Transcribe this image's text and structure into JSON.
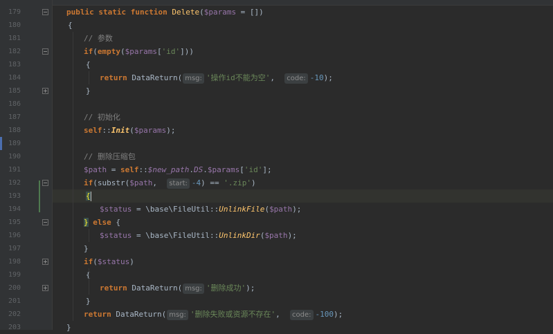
{
  "editor": {
    "lines": [
      {
        "n": "179",
        "parts": [
          [
            "kw",
            "public static function "
          ],
          [
            "fn",
            "Delete"
          ],
          [
            "txt",
            "("
          ],
          [
            "var",
            "$params"
          ],
          [
            "txt",
            " = [])"
          ]
        ]
      },
      {
        "n": "180",
        "parts": [
          [
            "txt",
            "{"
          ]
        ]
      },
      {
        "n": "181",
        "parts": [
          [
            "cmt",
            "// 参数"
          ]
        ]
      },
      {
        "n": "182",
        "parts": [
          [
            "kw",
            "if"
          ],
          [
            "txt",
            "("
          ],
          [
            "kw",
            "empty"
          ],
          [
            "txt",
            "("
          ],
          [
            "var",
            "$params"
          ],
          [
            "txt",
            "["
          ],
          [
            "str",
            "'id'"
          ],
          [
            "txt",
            "]))"
          ]
        ]
      },
      {
        "n": "183",
        "parts": [
          [
            "txt",
            "{"
          ]
        ]
      },
      {
        "n": "184",
        "parts": [
          [
            "kw",
            "return "
          ],
          [
            "txt",
            "DataReturn("
          ],
          [
            "hint",
            "msg:"
          ],
          [
            "str",
            "'操作id不能为空'"
          ],
          [
            "txt",
            ",  "
          ],
          [
            "hint",
            "code:"
          ],
          [
            "num",
            "-10"
          ],
          [
            "txt",
            ");"
          ]
        ]
      },
      {
        "n": "185",
        "parts": [
          [
            "txt",
            "}"
          ]
        ]
      },
      {
        "n": "186",
        "parts": []
      },
      {
        "n": "187",
        "parts": [
          [
            "cmt",
            "// 初始化"
          ]
        ]
      },
      {
        "n": "188",
        "parts": [
          [
            "kw",
            "self"
          ],
          [
            "txt",
            "::"
          ],
          [
            "ufn",
            "Init"
          ],
          [
            "txt",
            "("
          ],
          [
            "var",
            "$params"
          ],
          [
            "txt",
            ");"
          ]
        ]
      },
      {
        "n": "189",
        "parts": []
      },
      {
        "n": "190",
        "parts": [
          [
            "cmt",
            "// 删除压缩包"
          ]
        ]
      },
      {
        "n": "191",
        "parts": [
          [
            "var",
            "$path"
          ],
          [
            "txt",
            " = "
          ],
          [
            "kw",
            "self"
          ],
          [
            "txt",
            "::"
          ],
          [
            "konst",
            "$new_path"
          ],
          [
            "txt",
            "."
          ],
          [
            "konst",
            "DS"
          ],
          [
            "txt",
            "."
          ],
          [
            "var",
            "$params"
          ],
          [
            "txt",
            "["
          ],
          [
            "str",
            "'id'"
          ],
          [
            "txt",
            "];"
          ]
        ]
      },
      {
        "n": "192",
        "parts": [
          [
            "kw",
            "if"
          ],
          [
            "txt",
            "(substr("
          ],
          [
            "var",
            "$path"
          ],
          [
            "txt",
            ",  "
          ],
          [
            "hint",
            "start:"
          ],
          [
            "num",
            "-4"
          ],
          [
            "txt",
            ") == "
          ],
          [
            "str",
            "'.zip'"
          ],
          [
            "txt",
            ")"
          ]
        ]
      },
      {
        "n": "193",
        "parts": [
          [
            "brace",
            "{"
          ],
          [
            "caret",
            ""
          ]
        ]
      },
      {
        "n": "194",
        "parts": [
          [
            "var",
            "$status"
          ],
          [
            "txt",
            " = \\base\\FileUtil::"
          ],
          [
            "ifn",
            "UnlinkFile"
          ],
          [
            "txt",
            "("
          ],
          [
            "var",
            "$path"
          ],
          [
            "txt",
            ");"
          ]
        ]
      },
      {
        "n": "195",
        "parts": [
          [
            "brace",
            "}"
          ],
          [
            "kw",
            " else "
          ],
          [
            "txt",
            "{"
          ]
        ]
      },
      {
        "n": "196",
        "parts": [
          [
            "var",
            "$status"
          ],
          [
            "txt",
            " = \\base\\FileUtil::"
          ],
          [
            "ifn",
            "UnlinkDir"
          ],
          [
            "txt",
            "("
          ],
          [
            "var",
            "$path"
          ],
          [
            "txt",
            ");"
          ]
        ]
      },
      {
        "n": "197",
        "parts": [
          [
            "txt",
            "}"
          ]
        ]
      },
      {
        "n": "198",
        "parts": [
          [
            "kw",
            "if"
          ],
          [
            "txt",
            "("
          ],
          [
            "var",
            "$status"
          ],
          [
            "txt",
            ")"
          ]
        ]
      },
      {
        "n": "199",
        "parts": [
          [
            "txt",
            "{"
          ]
        ]
      },
      {
        "n": "200",
        "parts": [
          [
            "kw",
            "return "
          ],
          [
            "txt",
            "DataReturn("
          ],
          [
            "hint",
            "msg:"
          ],
          [
            "str",
            "'删除成功'"
          ],
          [
            "txt",
            ");"
          ]
        ]
      },
      {
        "n": "201",
        "parts": [
          [
            "txt",
            "}"
          ]
        ]
      },
      {
        "n": "202",
        "parts": [
          [
            "kw",
            "return "
          ],
          [
            "txt",
            "DataReturn("
          ],
          [
            "hint",
            "msg:"
          ],
          [
            "str",
            "'删除失败或资源不存在'"
          ],
          [
            "txt",
            ",  "
          ],
          [
            "hint",
            "code:"
          ],
          [
            "num",
            "-100"
          ],
          [
            "txt",
            ");"
          ]
        ]
      },
      {
        "n": "203",
        "parts": [
          [
            "txt",
            "}"
          ]
        ]
      }
    ]
  },
  "colors": {
    "background": "#2b2b2b",
    "gutter": "#313335",
    "keyword": "#cc7832",
    "string": "#6a8759",
    "number": "#6897bb",
    "variable": "#9876aa",
    "function": "#ffc66d",
    "comment": "#808080"
  }
}
